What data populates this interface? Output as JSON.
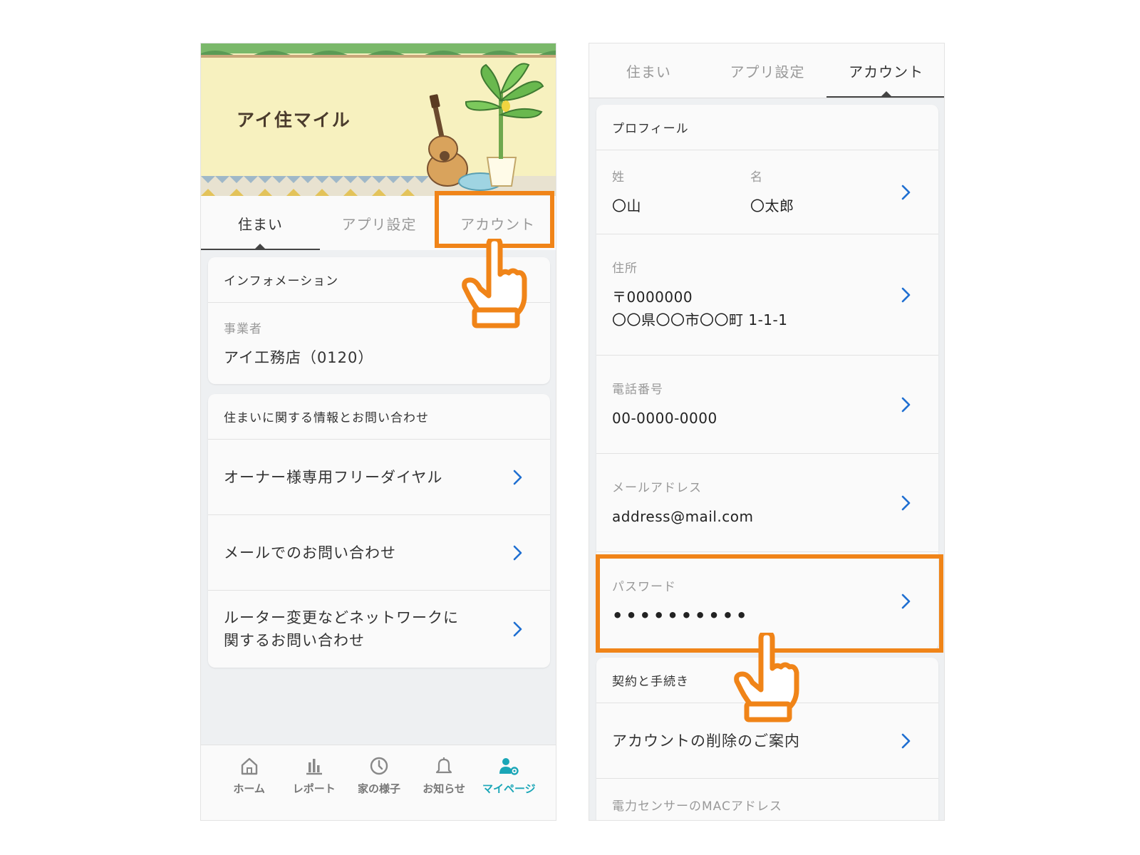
{
  "left": {
    "app_name": "アイ住マイル",
    "tabs": [
      {
        "label": "住まい"
      },
      {
        "label": "アプリ設定"
      },
      {
        "label": "アカウント"
      }
    ],
    "info_card": {
      "title": "インフォメーション",
      "provider_label": "事業者",
      "provider_value": "アイ工務店（0120）"
    },
    "contact_card": {
      "title": "住まいに関する情報とお問い合わせ",
      "items": [
        {
          "label": "オーナー様専用フリーダイヤル"
        },
        {
          "label": "メールでのお問い合わせ"
        },
        {
          "label": "ルーター変更などネットワークに\n関するお問い合わせ"
        }
      ]
    },
    "bottom_nav": [
      {
        "label": "ホーム",
        "icon": "home-icon"
      },
      {
        "label": "レポート",
        "icon": "bar-chart-icon"
      },
      {
        "label": "家の様子",
        "icon": "clock-icon"
      },
      {
        "label": "お知らせ",
        "icon": "bell-icon"
      },
      {
        "label": "マイページ",
        "icon": "user-gear-icon",
        "active": true
      }
    ]
  },
  "right": {
    "tabs": [
      {
        "label": "住まい"
      },
      {
        "label": "アプリ設定"
      },
      {
        "label": "アカウント"
      }
    ],
    "profile": {
      "title": "プロフィール",
      "last_name_label": "姓",
      "last_name": "〇山",
      "first_name_label": "名",
      "first_name": "〇太郎",
      "address_label": "住所",
      "postal": "〒0000000",
      "address": "〇〇県〇〇市〇〇町 1-1-1",
      "phone_label": "電話番号",
      "phone": "00-0000-0000",
      "email_label": "メールアドレス",
      "email": "address@mail.com",
      "password_label": "パスワード",
      "password": "••••••••••"
    },
    "contract": {
      "title": "契約と手続き",
      "delete_label": "アカウントの削除のご案内",
      "mac_label": "電力センサーのMACアドレス"
    }
  },
  "colors": {
    "accent": "#f08418",
    "chevron": "#1f6fd1",
    "active_nav": "#1aa6b7"
  }
}
